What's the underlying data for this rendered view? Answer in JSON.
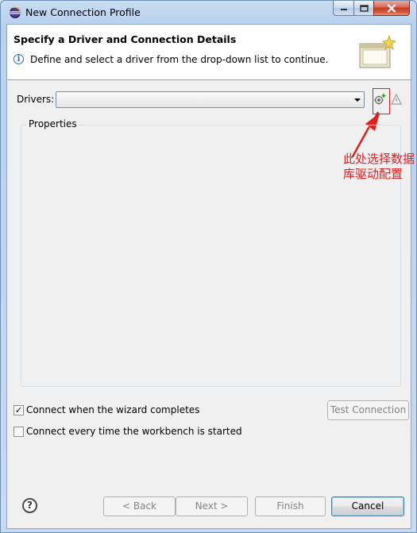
{
  "window": {
    "title": "New Connection Profile",
    "minimize_glyph": "—",
    "maximize_glyph": "□",
    "close_glyph": "✕"
  },
  "banner": {
    "title": "Specify a Driver and Connection Details",
    "info_glyph": "i",
    "description": "Define and select a driver from the drop-down list to continue."
  },
  "drivers": {
    "label": "Drivers:",
    "selected": "",
    "new_driver_icon": "new-driver-definition-icon",
    "edit_driver_icon": "edit-driver-definition-icon"
  },
  "properties": {
    "label": "Properties"
  },
  "annotation": {
    "text": "此处选择数据库驱动配置",
    "color": "#e02020"
  },
  "options": {
    "connect_on_finish": {
      "label": "Connect when the wizard completes",
      "checked": true,
      "glyph": "✓"
    },
    "connect_on_startup": {
      "label": "Connect every time the workbench is started",
      "checked": false,
      "glyph": ""
    }
  },
  "buttons": {
    "test_connection": "Test Connection",
    "back": "< Back",
    "next": "Next >",
    "finish": "Finish",
    "cancel": "Cancel",
    "help_glyph": "?"
  }
}
